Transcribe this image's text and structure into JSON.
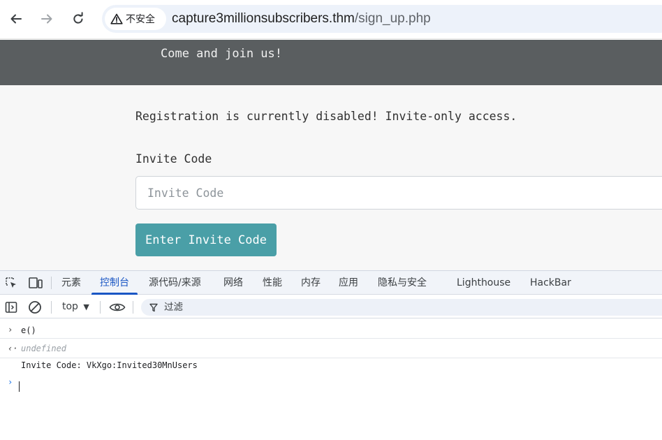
{
  "browser": {
    "security_label": "不安全",
    "url_host": "capture3millionsubscribers.thm",
    "url_path": "/sign_up.php",
    "icons": [
      "back-icon",
      "forward-icon",
      "reload-icon",
      "warning-icon"
    ]
  },
  "page": {
    "header_title": "Come and join us!",
    "notice": "Registration is currently disabled! Invite-only access.",
    "invite_label": "Invite Code",
    "invite_placeholder": "Invite Code",
    "submit_label": "Enter Invite Code"
  },
  "devtools": {
    "tabs": [
      "元素",
      "控制台",
      "源代码/来源",
      "网络",
      "性能",
      "内存",
      "应用",
      "隐私与安全",
      "Lighthouse",
      "HackBar"
    ],
    "active_tab": "控制台",
    "context": "top",
    "filter_placeholder": "过滤",
    "console": {
      "input": "e()",
      "result": "undefined",
      "log": "Invite Code: VkXgo:Invited30MnUsers"
    },
    "colors": {
      "accent": "#1a56c4",
      "button": "#4a9fa7",
      "header": "#5a5e60"
    }
  }
}
